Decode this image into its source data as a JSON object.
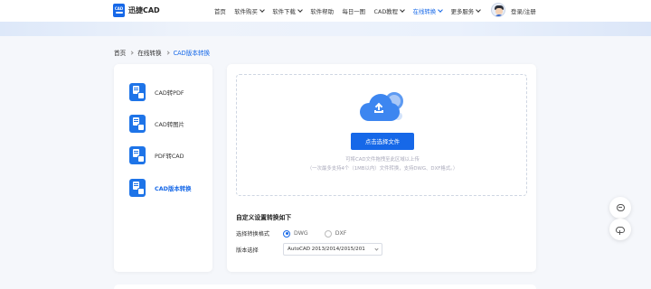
{
  "header": {
    "logo_mark": "CAD",
    "logo_text": "迅捷CAD",
    "nav": [
      {
        "label": "首页",
        "dropdown": false,
        "active": false
      },
      {
        "label": "软件购买",
        "dropdown": true,
        "active": false
      },
      {
        "label": "软件下载",
        "dropdown": true,
        "active": false
      },
      {
        "label": "软件帮助",
        "dropdown": false,
        "active": false
      },
      {
        "label": "每日一图",
        "dropdown": false,
        "active": false
      },
      {
        "label": "CAD教程",
        "dropdown": true,
        "active": false
      },
      {
        "label": "在线转换",
        "dropdown": true,
        "active": true
      },
      {
        "label": "更多服务",
        "dropdown": true,
        "active": false
      }
    ],
    "login": "登录/注册"
  },
  "breadcrumb": {
    "home": "首页",
    "section": "在线转换",
    "current": "CAD版本转换"
  },
  "sidebar": {
    "items": [
      {
        "label": "CAD转PDF",
        "active": false
      },
      {
        "label": "CAD转图片",
        "active": false
      },
      {
        "label": "PDF转CAD",
        "active": false
      },
      {
        "label": "CAD版本转换",
        "active": true
      }
    ]
  },
  "upload": {
    "button": "点击选择文件",
    "hint_primary": "可将CAD文件拖拽至此区域以上传",
    "hint_secondary": "（一次最多支持4个（1MB以内）文件转换，支持DWG、DXF格式。）"
  },
  "settings": {
    "title": "自定义设置转换如下",
    "format_label": "选择转换格式",
    "format_options": [
      "DWG",
      "DXF"
    ],
    "format_selected": "DWG",
    "version_label": "版本选择",
    "version_value": "AutoCAD 2013/2014/2015/201"
  },
  "colors": {
    "accent": "#1668e8",
    "background": "#f5f7fb"
  },
  "icons": {
    "float_top": "chat-icon",
    "float_bottom": "cloud-download-icon"
  }
}
